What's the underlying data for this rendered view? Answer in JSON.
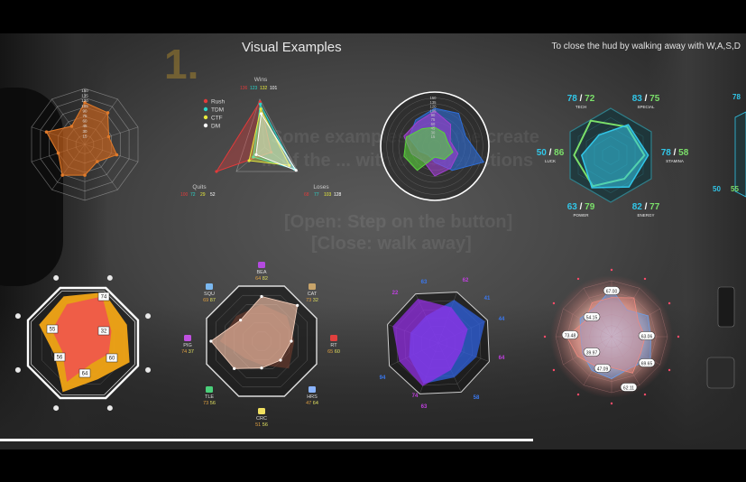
{
  "hud": {
    "title": "Visual Examples",
    "hint": "To close the hud by walking away with W,A,S,D",
    "scene_number": "1.",
    "ghost_lines": [
      "Some examples of ... the create",
      "... of the ... with our interactions",
      "[Open: Step on the button]",
      "[Close: walk away]"
    ],
    "progress_fraction": 0.715
  },
  "chart_data": [
    {
      "type": "radar",
      "id": "orange-decagon",
      "scale_labels": [
        "150",
        "135",
        "120",
        "105",
        "90",
        "75",
        "60",
        "45",
        "30",
        "15"
      ],
      "values": [
        0.75,
        0.7,
        0.45,
        0.6,
        0.38,
        0.55,
        0.68,
        0.5,
        0.72,
        0.4
      ],
      "colors": {
        "fill": "#d0661c",
        "stroke": "#e07a2a"
      }
    },
    {
      "type": "radar",
      "id": "game-modes",
      "axes": [
        "Wins",
        "Quits",
        "Loses"
      ],
      "axis_values": {
        "Wins": [
          "136",
          "123",
          "132",
          "101"
        ],
        "Quits": [
          "100",
          "72",
          "29",
          "52"
        ],
        "Loses": [
          "68",
          "77",
          "103",
          "128"
        ]
      },
      "series": [
        {
          "name": "Rush",
          "color": "#e23a3a"
        },
        {
          "name": "TDM",
          "color": "#2ad4c9"
        },
        {
          "name": "CTF",
          "color": "#e8ea3c"
        },
        {
          "name": "DM",
          "color": "#ffffff"
        }
      ]
    },
    {
      "type": "radar",
      "id": "circle-triple",
      "scale_labels": [
        "150",
        "135",
        "120",
        "105",
        "90",
        "75",
        "60",
        "45",
        "30",
        "15"
      ],
      "series_colors": [
        "#2e6ed8",
        "#a040d0",
        "#5ad43c"
      ]
    },
    {
      "type": "radar",
      "id": "hex-stats",
      "axes": [
        {
          "label": "TECH",
          "a": "78",
          "b": "72"
        },
        {
          "label": "SPECIAL",
          "a": "83",
          "b": "75"
        },
        {
          "label": "STAMINA",
          "a": "78",
          "b": "58"
        },
        {
          "label": "ENERGY",
          "a": "82",
          "b": "77"
        },
        {
          "label": "POWER",
          "a": "63",
          "b": "79"
        },
        {
          "label": "LUCK",
          "a": "50",
          "b": "86"
        }
      ],
      "colors": {
        "a": "#31c6e8",
        "b": "#7be06a"
      }
    },
    {
      "type": "radar",
      "id": "octagon-values",
      "data_labels": [
        "74",
        "32",
        "60",
        "64",
        "56",
        "55"
      ],
      "colors": {
        "outer": "#f2a516",
        "inner": "#ef5a4a"
      }
    },
    {
      "type": "radar",
      "id": "creature-octagon",
      "axes": [
        {
          "label": "BEA",
          "a": "64",
          "b": "82"
        },
        {
          "label": "CAT",
          "a": "73",
          "b": "32"
        },
        {
          "label": "RT",
          "a": "65",
          "b": "60"
        },
        {
          "label": "HRS",
          "a": "47",
          "b": "64"
        },
        {
          "label": "CRC",
          "a": "51",
          "b": "56"
        },
        {
          "label": "TLE",
          "a": "73",
          "b": "56"
        },
        {
          "label": "PIG",
          "a": "74",
          "b": "37"
        },
        {
          "label": "SQU",
          "a": "69",
          "b": "87"
        }
      ]
    },
    {
      "type": "radar",
      "id": "tilted-octagon",
      "numbers": [
        "63",
        "62",
        "44",
        "64",
        "58",
        "63",
        "94",
        "22",
        "41",
        "74"
      ],
      "colors": {
        "a": "#2f62e0",
        "b": "#9a2ff0"
      }
    },
    {
      "type": "radar",
      "id": "pink-glow",
      "data_labels": [
        "67.00",
        "54.15",
        "73.48",
        "39.97",
        "47.09",
        "63.06",
        "69.65",
        "62.11"
      ],
      "colors": {
        "a": "#6aa0ee",
        "b": "#f08a80"
      }
    },
    {
      "type": "panel",
      "id": "edge-right",
      "values": [
        "78",
        "50",
        "55"
      ]
    }
  ]
}
